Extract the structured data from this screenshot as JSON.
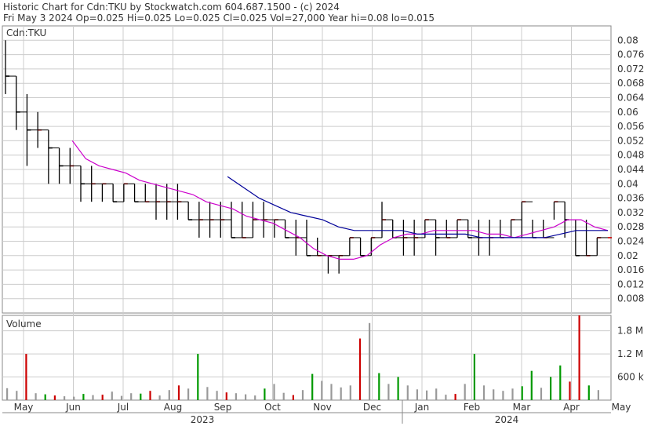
{
  "header": {
    "line1": "Historic Chart for Cdn:TKU by Stockwatch.com 604.687.1500 - (c) 2024",
    "line2": "Fri May  3 2024  Op=0.025  Hi=0.025  Lo=0.025  Cl=0.025  Vol=27,000  Year hi=0.08  lo=0.015"
  },
  "chart_data": [
    {
      "type": "ohlc",
      "title": "Cdn:TKU",
      "ylim": [
        0.004,
        0.084
      ],
      "yticks": [
        "0.08",
        "0.076",
        "0.072",
        "0.068",
        "0.064",
        "0.06",
        "0.056",
        "0.052",
        "0.048",
        "0.044",
        "0.04",
        "0.036",
        "0.032",
        "0.028",
        "0.024",
        "0.02",
        "0.016",
        "0.012",
        "0.008"
      ],
      "ytick_values": [
        0.08,
        0.076,
        0.072,
        0.068,
        0.064,
        0.06,
        0.056,
        0.052,
        0.048,
        0.044,
        0.04,
        0.036,
        0.032,
        0.028,
        0.024,
        0.02,
        0.016,
        0.012,
        0.008
      ],
      "grid": true,
      "colors": {
        "bar": "#000000",
        "up_tick": "#cc0000",
        "ma_short": "#cc00cc",
        "ma_long": "#000099",
        "grid": "#cccccc"
      },
      "x": [
        "2023-05-03",
        "2023-05-05",
        "2023-05-10",
        "2023-05-15",
        "2023-05-20",
        "2023-05-25",
        "2023-05-30",
        "2023-06-05",
        "2023-06-10",
        "2023-06-15",
        "2023-06-20",
        "2023-06-25",
        "2023-07-01",
        "2023-07-06",
        "2023-07-12",
        "2023-07-18",
        "2023-07-25",
        "2023-08-01",
        "2023-08-08",
        "2023-08-15",
        "2023-08-22",
        "2023-08-29",
        "2023-09-05",
        "2023-09-12",
        "2023-09-19",
        "2023-09-26",
        "2023-10-03",
        "2023-10-10",
        "2023-10-17",
        "2023-10-24",
        "2023-10-31",
        "2023-11-07",
        "2023-11-14",
        "2023-11-21",
        "2023-11-28",
        "2023-12-05",
        "2023-12-12",
        "2023-12-19",
        "2024-01-02",
        "2024-01-09",
        "2024-01-16",
        "2024-01-23",
        "2024-01-30",
        "2024-02-06",
        "2024-02-13",
        "2024-02-20",
        "2024-02-27",
        "2024-03-05",
        "2024-03-12",
        "2024-03-19",
        "2024-03-26",
        "2024-04-02",
        "2024-04-09",
        "2024-04-16",
        "2024-04-23",
        "2024-04-30",
        "2024-05-03"
      ],
      "series": [
        {
          "name": "price",
          "high": [
            0.08,
            0.07,
            0.065,
            0.06,
            0.055,
            0.05,
            0.05,
            0.045,
            0.045,
            0.04,
            0.04,
            0.04,
            0.04,
            0.04,
            0.04,
            0.04,
            0.04,
            0.035,
            0.035,
            0.035,
            0.035,
            0.035,
            0.035,
            0.035,
            0.035,
            0.03,
            0.03,
            0.03,
            0.03,
            0.025,
            0.02,
            0.02,
            0.025,
            0.025,
            0.025,
            0.035,
            0.03,
            0.03,
            0.03,
            0.03,
            0.03,
            0.03,
            0.03,
            0.03,
            0.03,
            0.03,
            0.03,
            0.03,
            0.035,
            0.03,
            0.03,
            0.035,
            0.035,
            0.03,
            0.03,
            0.025,
            0.025
          ],
          "low": [
            0.065,
            0.055,
            0.045,
            0.05,
            0.04,
            0.04,
            0.04,
            0.035,
            0.035,
            0.035,
            0.035,
            0.035,
            0.035,
            0.035,
            0.03,
            0.03,
            0.03,
            0.03,
            0.025,
            0.025,
            0.025,
            0.025,
            0.025,
            0.025,
            0.025,
            0.025,
            0.025,
            0.02,
            0.02,
            0.02,
            0.015,
            0.015,
            0.02,
            0.02,
            0.02,
            0.025,
            0.025,
            0.02,
            0.02,
            0.025,
            0.02,
            0.025,
            0.025,
            0.025,
            0.02,
            0.02,
            0.025,
            0.025,
            0.025,
            0.025,
            0.025,
            0.03,
            0.025,
            0.02,
            0.02,
            0.02,
            0.025
          ],
          "close": [
            0.07,
            0.06,
            0.055,
            0.055,
            0.05,
            0.045,
            0.045,
            0.04,
            0.04,
            0.04,
            0.035,
            0.04,
            0.035,
            0.035,
            0.035,
            0.035,
            0.035,
            0.03,
            0.03,
            0.03,
            0.03,
            0.025,
            0.025,
            0.03,
            0.03,
            0.03,
            0.025,
            0.025,
            0.02,
            0.02,
            0.02,
            0.02,
            0.025,
            0.02,
            0.025,
            0.03,
            0.025,
            0.025,
            0.025,
            0.03,
            0.025,
            0.025,
            0.03,
            0.025,
            0.025,
            0.025,
            0.025,
            0.03,
            0.035,
            0.025,
            0.025,
            0.035,
            0.03,
            0.02,
            0.02,
            0.025,
            0.025
          ]
        },
        {
          "name": "ma_short",
          "x_start": 0.115,
          "values": [
            0.052,
            0.047,
            0.045,
            0.044,
            0.043,
            0.041,
            0.04,
            0.039,
            0.038,
            0.037,
            0.035,
            0.034,
            0.033,
            0.031,
            0.03,
            0.029,
            0.027,
            0.025,
            0.022,
            0.02,
            0.019,
            0.019,
            0.02,
            0.023,
            0.025,
            0.026,
            0.026,
            0.027,
            0.027,
            0.027,
            0.027,
            0.026,
            0.026,
            0.025,
            0.026,
            0.027,
            0.028,
            0.03,
            0.03,
            0.028,
            0.027
          ]
        },
        {
          "name": "ma_long",
          "x_start": 0.37,
          "values": [
            0.042,
            0.039,
            0.036,
            0.034,
            0.032,
            0.031,
            0.03,
            0.028,
            0.027,
            0.027,
            0.027,
            0.027,
            0.026,
            0.026,
            0.026,
            0.026,
            0.025,
            0.025,
            0.025,
            0.025,
            0.025,
            0.026,
            0.027,
            0.027,
            0.027
          ]
        }
      ]
    },
    {
      "type": "bar",
      "title": "Volume",
      "ylim": [
        0,
        2200000
      ],
      "yticks": [
        "1.8 M",
        "1.2 M",
        "600 k"
      ],
      "ytick_values": [
        1800000,
        1200000,
        600000
      ],
      "colors": {
        "up": "#009900",
        "down": "#cc0000",
        "flat": "#999999"
      },
      "values": [
        310000,
        240000,
        1200000,
        180000,
        150000,
        120000,
        100000,
        90000,
        160000,
        130000,
        140000,
        220000,
        110000,
        180000,
        170000,
        240000,
        120000,
        260000,
        380000,
        300000,
        1200000,
        340000,
        240000,
        200000,
        180000,
        150000,
        120000,
        300000,
        420000,
        190000,
        130000,
        260000,
        680000,
        500000,
        420000,
        330000,
        380000,
        1600000,
        2000000,
        700000,
        420000,
        600000,
        380000,
        280000,
        250000,
        300000,
        140000,
        160000,
        420000,
        1200000,
        380000,
        280000,
        240000,
        300000,
        360000,
        760000,
        320000,
        600000,
        900000,
        480000,
        2200000,
        380000,
        260000
      ],
      "bar_colors": [
        "flat",
        "flat",
        "down",
        "flat",
        "up",
        "down",
        "flat",
        "flat",
        "up",
        "flat",
        "down",
        "flat",
        "flat",
        "flat",
        "up",
        "down",
        "flat",
        "flat",
        "down",
        "flat",
        "up",
        "flat",
        "flat",
        "down",
        "flat",
        "flat",
        "flat",
        "up",
        "flat",
        "flat",
        "down",
        "flat",
        "up",
        "flat",
        "flat",
        "flat",
        "flat",
        "down",
        "flat",
        "up",
        "flat",
        "up",
        "flat",
        "flat",
        "flat",
        "flat",
        "flat",
        "down",
        "flat",
        "up",
        "flat",
        "flat",
        "flat",
        "flat",
        "up",
        "up",
        "flat",
        "up",
        "up",
        "down",
        "down",
        "up",
        "flat"
      ]
    }
  ],
  "x_axis": {
    "months": [
      "May",
      "Jun",
      "Jul",
      "Aug",
      "Sep",
      "Oct",
      "Nov",
      "Dec",
      "Jan",
      "Feb",
      "Mar",
      "Apr",
      "May"
    ],
    "years": [
      "2023",
      "2024"
    ]
  }
}
